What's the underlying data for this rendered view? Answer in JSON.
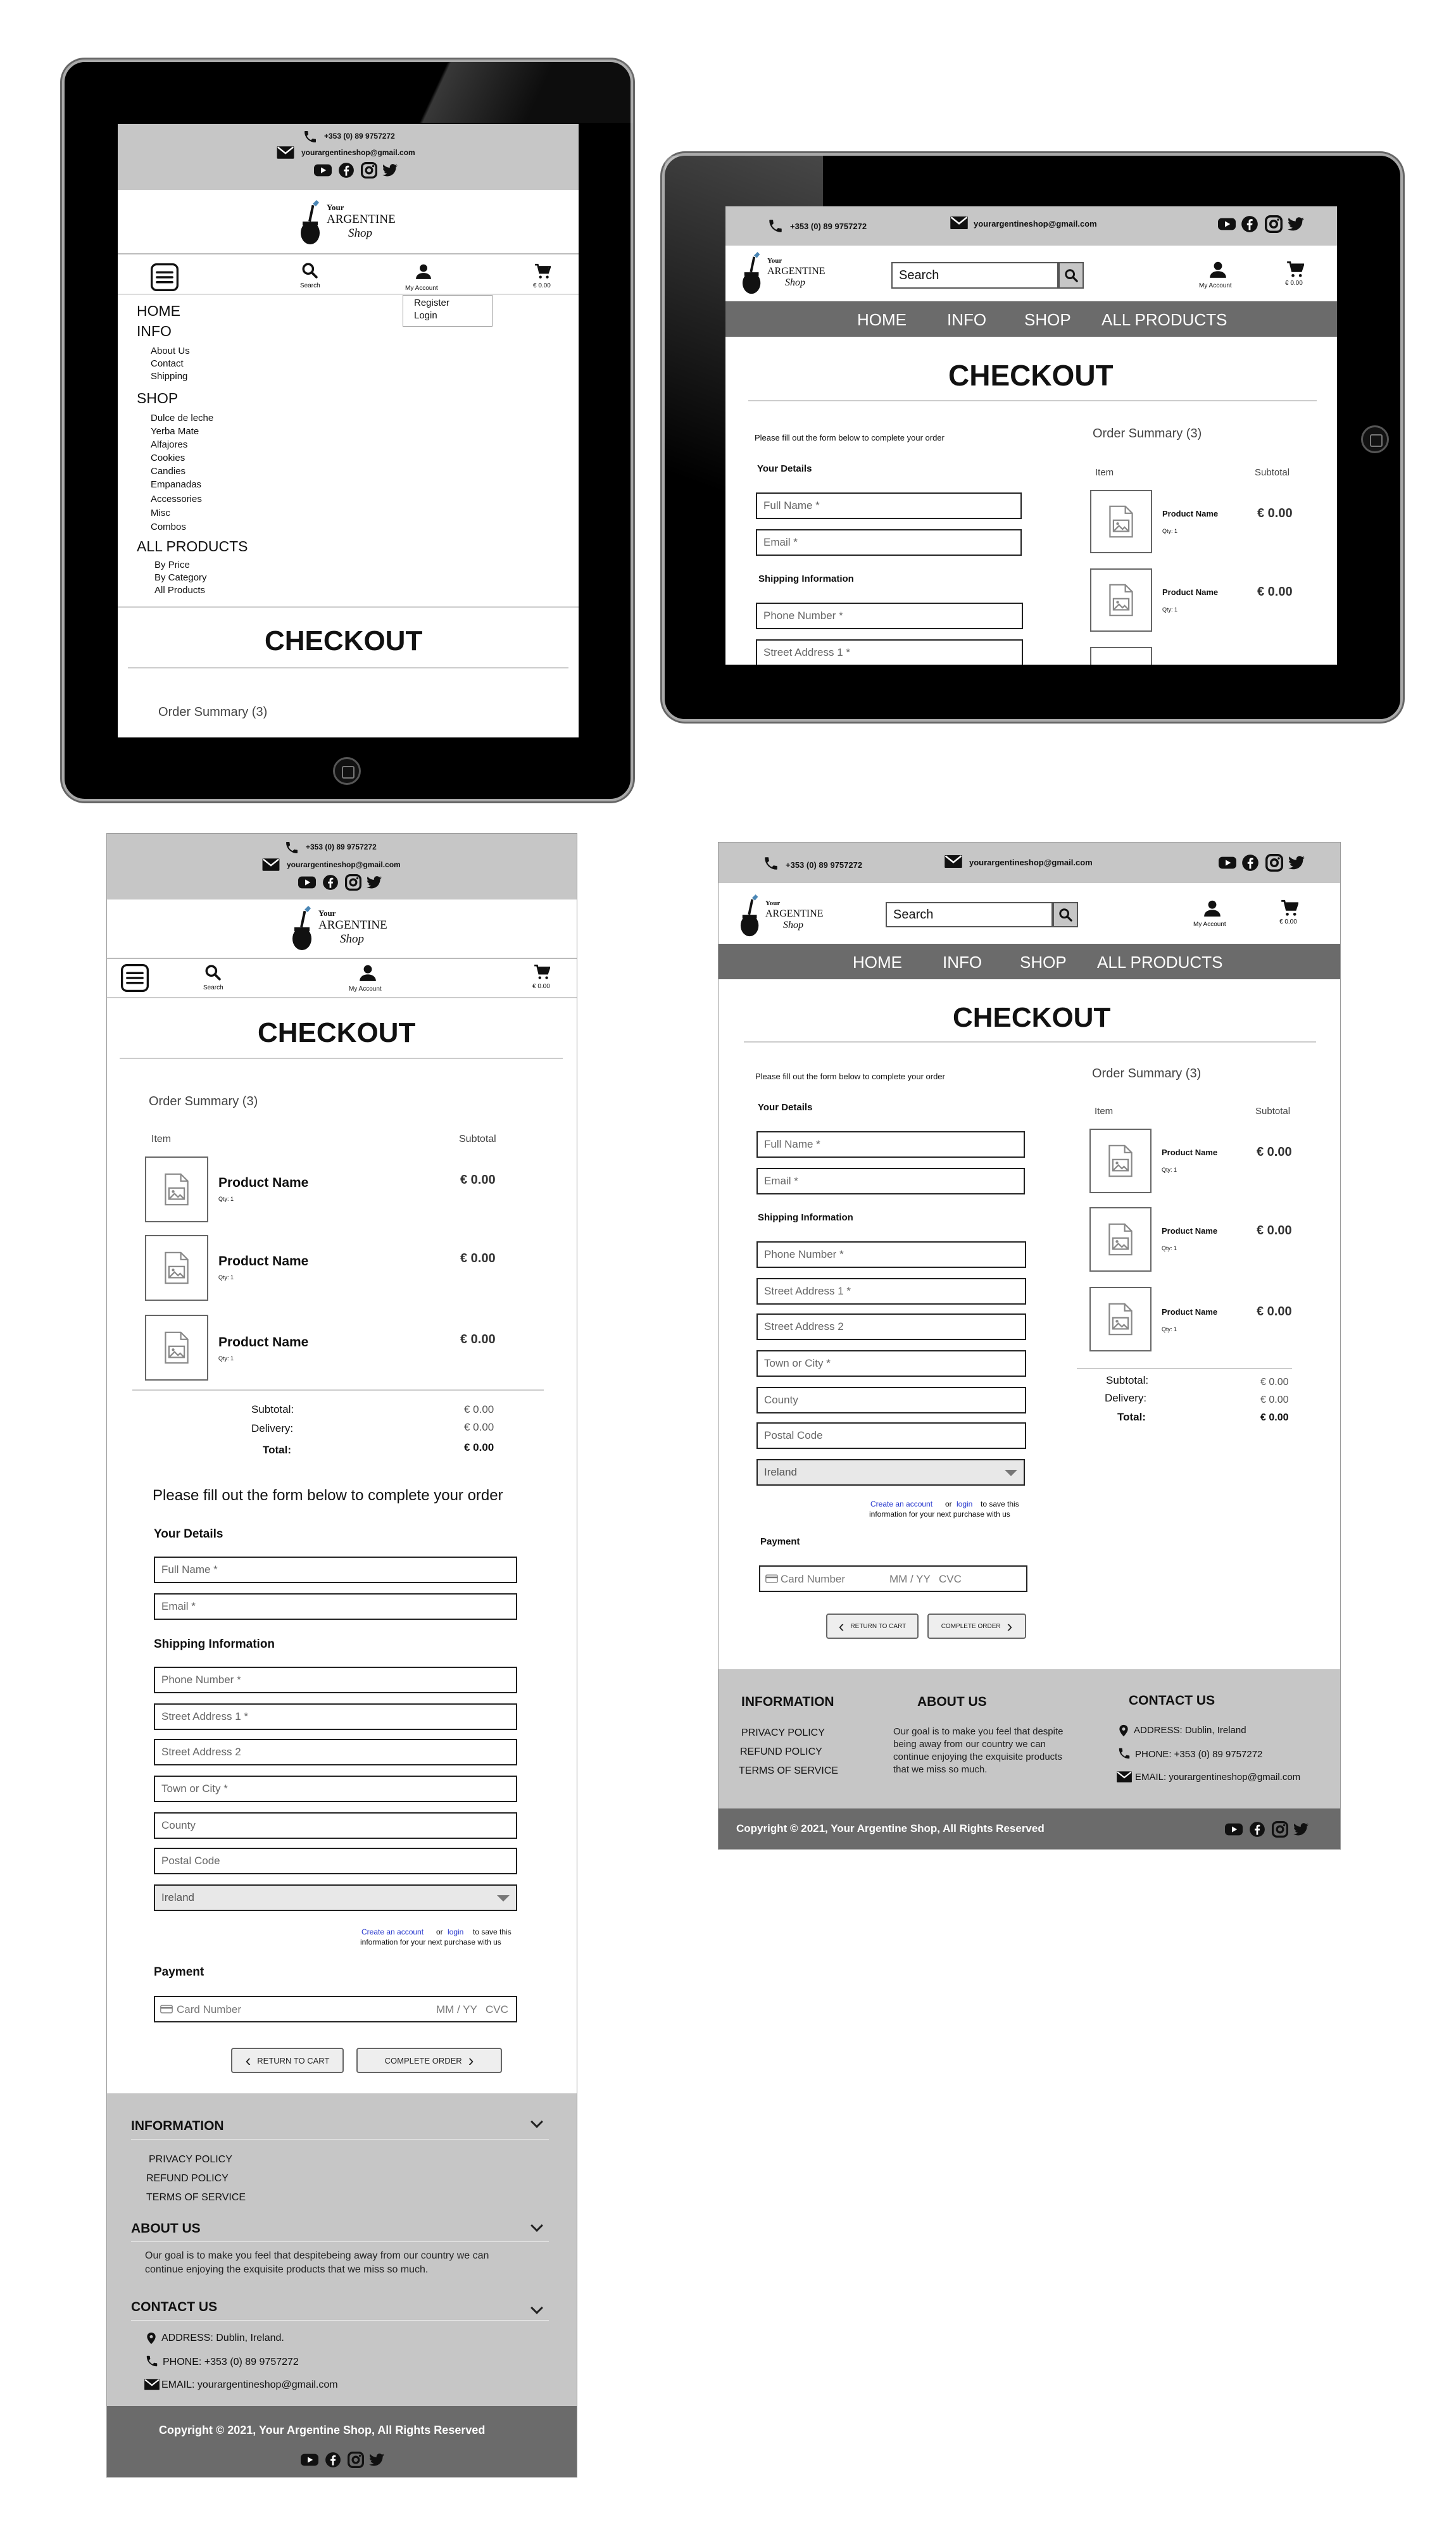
{
  "contact": {
    "phone": "+353 (0) 89 9757272",
    "email": "yourargentineshop@gmail.com"
  },
  "brand": {
    "your": "Your",
    "argentine": "ARGENTINE",
    "shop": "Shop"
  },
  "header": {
    "search_label": "Search",
    "search_placeholder": "Search",
    "account_label": "My Account",
    "cart_amount": "€ 0.00"
  },
  "account_menu": [
    "Register",
    "Login"
  ],
  "nav": {
    "home": "HOME",
    "info": "INFO",
    "shop": "SHOP",
    "all_products": "ALL PRODUCTS"
  },
  "mobile_menu": {
    "home": "HOME",
    "info": "INFO",
    "info_items": [
      "About Us",
      "Contact",
      "Shipping"
    ],
    "shop": "SHOP",
    "shop_items": [
      "Dulce de leche",
      "Yerba Mate",
      "Alfajores",
      "Cookies",
      "Candies",
      "Empanadas",
      "Accessories",
      "Misc",
      "Combos"
    ],
    "all_products": "ALL PRODUCTS",
    "all_items": [
      "By Price",
      "By Category",
      "All Products"
    ]
  },
  "checkout": {
    "title": "CHECKOUT",
    "intro": "Please fill out the form below to complete your order",
    "your_details": "Your Details",
    "shipping_info": "Shipping Information",
    "full_name": "Full Name *",
    "email": "Email *",
    "phone": "Phone Number *",
    "street1": "Street Address 1 *",
    "street2": "Street Address 2",
    "town": "Town or City *",
    "county": "County",
    "postal": "Postal Code",
    "country": "Ireland",
    "create_account": "Create an account",
    "or": "or",
    "login": "login",
    "save_tail": "to save this",
    "save_tail2": "information for your next purchase with us",
    "payment": "Payment",
    "card_number": "Card Number",
    "mm_yy": "MM / YY",
    "cvc": "CVC",
    "return_btn": "RETURN TO CART",
    "complete_btn": "COMPLETE ORDER"
  },
  "summary": {
    "title": "Order Summary (3)",
    "item_col": "Item",
    "subtotal_col": "Subtotal",
    "items": [
      {
        "name": "Product Name",
        "qty": "Qty: 1",
        "price": "€ 0.00"
      },
      {
        "name": "Product Name",
        "qty": "Qty: 1",
        "price": "€ 0.00"
      },
      {
        "name": "Product Name",
        "qty": "Qty: 1",
        "price": "€ 0.00"
      }
    ],
    "subtotal_label": "Subtotal:",
    "subtotal_value": "€ 0.00",
    "delivery_label": "Delivery:",
    "delivery_value": "€ 0.00",
    "total_label": "Total:",
    "total_value": "€ 0.00"
  },
  "footer": {
    "information": "INFORMATION",
    "links": [
      "PRIVACY POLICY",
      "REFUND POLICY",
      "TERMS OF SERVICE"
    ],
    "about": "ABOUT US",
    "about_text_desktop": [
      "Our goal is to make you feel that despite",
      "being away from our country we can",
      "continue enjoying the exquisite products",
      "that we miss so much."
    ],
    "about_text_mobile": [
      "Our goal is to make you feel that despitebeing away from our country we can",
      "continue enjoying the exquisite products that we miss so much."
    ],
    "contact": "CONTACT US",
    "address": "ADDRESS: Dublin, Ireland",
    "address_mobile": "ADDRESS: Dublin, Ireland.",
    "phone": "PHONE: +353 (0) 89 9757272",
    "email": "EMAIL: yourargentineshop@gmail.com",
    "copyright": "Copyright © 2021, Your Argentine Shop,  All Rights Reserved"
  },
  "icons": [
    "phone-icon",
    "mail-icon",
    "youtube-icon",
    "facebook-icon",
    "instagram-icon",
    "twitter-icon",
    "search-icon",
    "user-icon",
    "cart-icon",
    "hamburger-icon",
    "image-placeholder-icon",
    "card-icon",
    "location-icon",
    "chevron-icon"
  ]
}
